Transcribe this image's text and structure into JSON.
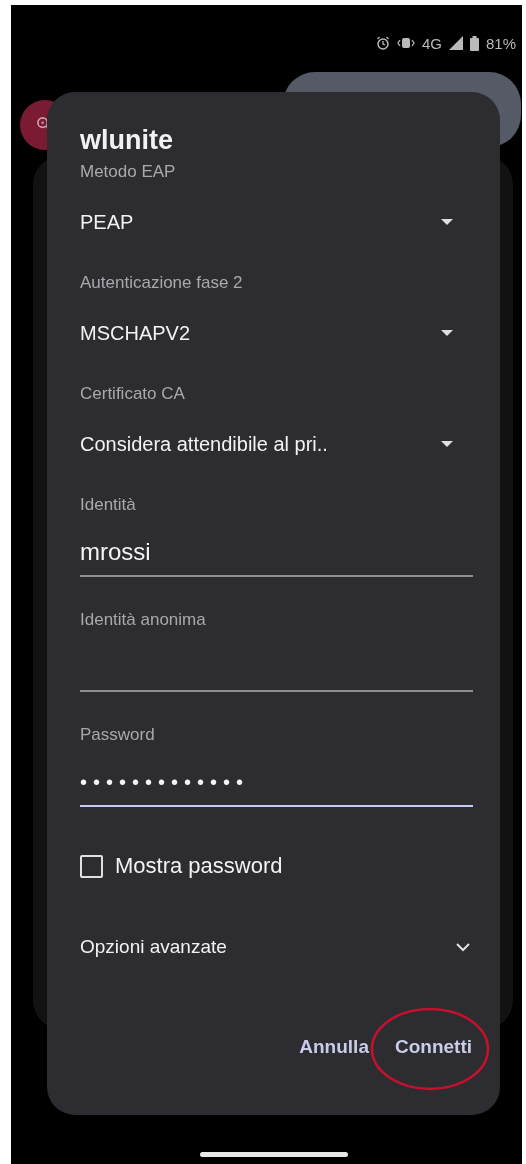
{
  "status_bar": {
    "network": "4G",
    "battery": "81%"
  },
  "dialog": {
    "title": "wlunite",
    "fields": [
      {
        "kind": "dropdown",
        "label": "Metodo EAP",
        "value": "PEAP"
      },
      {
        "kind": "dropdown",
        "label": "Autenticazione fase 2",
        "value": "MSCHAPV2"
      },
      {
        "kind": "dropdown",
        "label": "Certificato CA",
        "value": "Considera attendibile al pri.."
      },
      {
        "kind": "text",
        "label": "Identità",
        "value": "mrossi",
        "focused": false
      },
      {
        "kind": "text",
        "label": "Identità anonima",
        "focused": false
      },
      {
        "kind": "password",
        "label": "Password",
        "value": "•••••••••••••",
        "focused": true
      }
    ],
    "show_password": {
      "label": "Mostra password",
      "checked": false
    },
    "advanced": {
      "label": "Opzioni avanzate",
      "expanded": false
    },
    "buttons": [
      {
        "label": "Annulla",
        "circled": false
      },
      {
        "label": "Connetti",
        "circled": true
      }
    ]
  }
}
